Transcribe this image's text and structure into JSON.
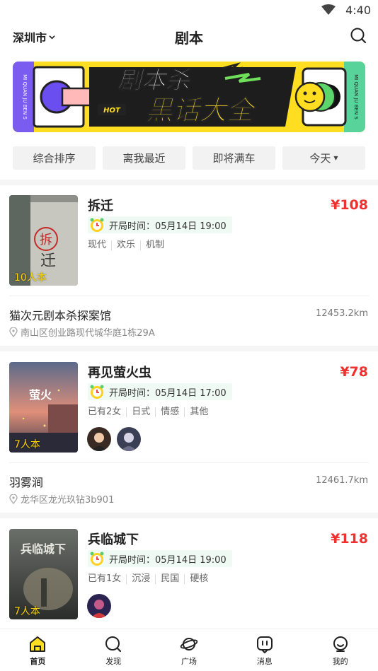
{
  "status": {
    "time": "4:40"
  },
  "nav": {
    "city": "深圳市",
    "title": "剧本"
  },
  "banner": {
    "line1": "剧本杀",
    "line2": "黑话大全",
    "hot": "HOT",
    "side_left": "MI QUAN JU BEN S",
    "side_right": "MI QUAN JU BEN S"
  },
  "filters": [
    {
      "label": "综合排序"
    },
    {
      "label": "离我最近"
    },
    {
      "label": "即将满车"
    },
    {
      "label": "今天"
    }
  ],
  "cards": [
    {
      "title": "拆迁",
      "price": "¥108",
      "time_label": "开局时间：",
      "time_value": "05月14日 19:00",
      "people": "10人本",
      "tags": [
        "现代",
        "欢乐",
        "机制"
      ],
      "venue": "猫次元剧本杀探案馆",
      "distance": "12453.2km",
      "address": "南山区创业路现代城华庭1栋29A"
    },
    {
      "title": "再见萤火虫",
      "price": "¥78",
      "time_label": "开局时间：",
      "time_value": "05月14日 17:00",
      "people": "7人本",
      "tags": [
        "已有2女",
        "日式",
        "情感",
        "其他"
      ],
      "venue": "羽雾涧",
      "distance": "12461.7km",
      "address": "龙华区龙光玖钻3b901"
    },
    {
      "title": "兵临城下",
      "price": "¥118",
      "time_label": "开局时间：",
      "time_value": "05月14日 19:00",
      "people": "7人本",
      "tags": [
        "已有1女",
        "沉浸",
        "民国",
        "硬核"
      ]
    }
  ],
  "tabs": [
    {
      "label": "首页"
    },
    {
      "label": "发现"
    },
    {
      "label": "广场"
    },
    {
      "label": "消息"
    },
    {
      "label": "我的"
    }
  ],
  "colors": {
    "accent": "#ffde21",
    "price": "#f0302e",
    "time_bg": "#f0faf5"
  }
}
